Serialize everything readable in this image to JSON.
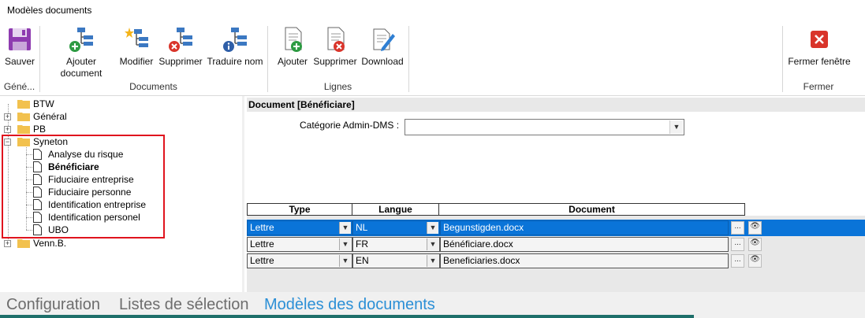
{
  "window": {
    "title": "Modèles documents"
  },
  "ribbon": {
    "general": {
      "label": "Géné...",
      "save": "Sauver"
    },
    "documents": {
      "label": "Documents",
      "add": "Ajouter document",
      "modify": "Modifier",
      "delete": "Supprimer",
      "translate": "Traduire nom"
    },
    "lignes": {
      "label": "Lignes",
      "add": "Ajouter",
      "delete": "Supprimer",
      "download": "Download"
    },
    "fermer": {
      "label": "Fermer",
      "close": "Fermer fenêtre"
    }
  },
  "tree": {
    "items": [
      {
        "label": "BTW"
      },
      {
        "label": "Général"
      },
      {
        "label": "PB"
      },
      {
        "label": "Syneton"
      },
      {
        "label": "Analyse du risque"
      },
      {
        "label": "Bénéficiare"
      },
      {
        "label": "Fiduciaire entreprise"
      },
      {
        "label": "Fiduciaire personne"
      },
      {
        "label": "Identification entreprise"
      },
      {
        "label": "Identification personel"
      },
      {
        "label": "UBO"
      },
      {
        "label": "Venn.B."
      }
    ],
    "expanders": {
      "plus": "+",
      "minus": "−"
    }
  },
  "details": {
    "header": "Document [Bénéficiare]",
    "category_label": "Catégorie Admin-DMS :",
    "category_value": "",
    "grid": {
      "columns": [
        "Type",
        "Langue",
        "Document"
      ],
      "rows": [
        {
          "type": "Lettre",
          "lang": "NL",
          "doc": "Begunstigden.docx"
        },
        {
          "type": "Lettre",
          "lang": "FR",
          "doc": "Bénéficiare.docx"
        },
        {
          "type": "Lettre",
          "lang": "EN",
          "doc": "Beneficiaries.docx"
        }
      ],
      "browse": "...",
      "view": "👁"
    }
  },
  "tabs": [
    "Configuration",
    "Listes de sélection",
    "Modèles des documents"
  ],
  "colors": {
    "accent": "#0a74d8",
    "highlight": "#e0141e",
    "active_tab": "#2b8fd6"
  }
}
